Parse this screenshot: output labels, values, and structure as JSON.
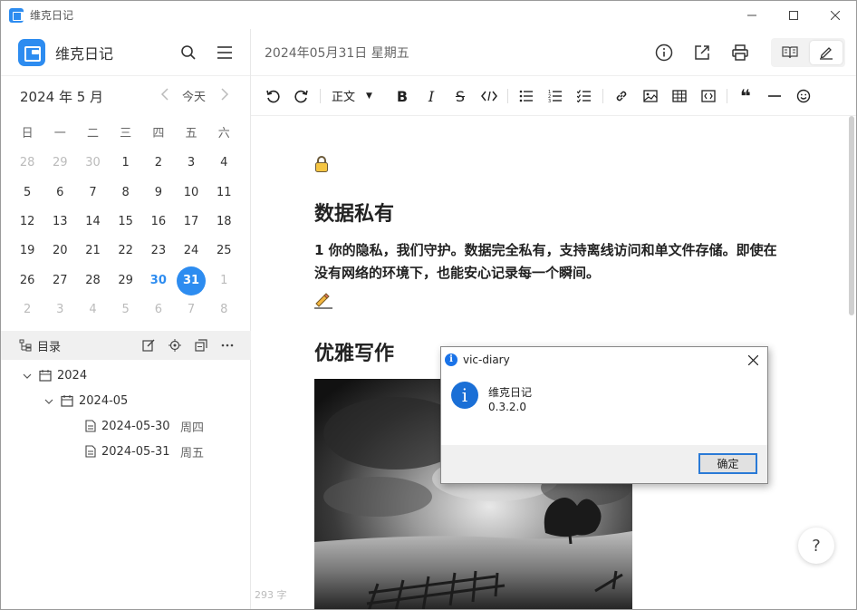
{
  "window": {
    "title": "维克日记"
  },
  "sidebar": {
    "app_name": "维克日记",
    "calendar": {
      "title": "2024 年 5 月",
      "today_label": "今天",
      "weekdays": [
        "日",
        "一",
        "二",
        "三",
        "四",
        "五",
        "六"
      ],
      "weeks": [
        [
          "28",
          "29",
          "30",
          "1",
          "2",
          "3",
          "4"
        ],
        [
          "5",
          "6",
          "7",
          "8",
          "9",
          "10",
          "11"
        ],
        [
          "12",
          "13",
          "14",
          "15",
          "16",
          "17",
          "18"
        ],
        [
          "19",
          "20",
          "21",
          "22",
          "23",
          "24",
          "25"
        ],
        [
          "26",
          "27",
          "28",
          "29",
          "30",
          "31",
          "1"
        ],
        [
          "2",
          "3",
          "4",
          "5",
          "6",
          "7",
          "8"
        ]
      ],
      "selected": "31",
      "highlighted": "30"
    },
    "toc_label": "目录",
    "tree": {
      "year": "2024",
      "month": "2024-05",
      "entries": [
        {
          "date": "2024-05-30",
          "weekday": "周四"
        },
        {
          "date": "2024-05-31",
          "weekday": "周五"
        }
      ]
    }
  },
  "main": {
    "date_title": "2024年05月31日 星期五",
    "toolbar": {
      "heading_select": "正文"
    },
    "content": {
      "emoji1": "🔒",
      "heading1": "数据私有",
      "paragraph1": "1 你的隐私，我们守护。数据完全私有，支持离线访问和单文件存储。即使在没有网络的环境下，也能安心记录每一个瞬间。",
      "emoji2": "✍",
      "heading2": "优雅写作"
    },
    "word_count": "293 字",
    "help_label": "?"
  },
  "dialog": {
    "title": "vic-diary",
    "line1": "维克日记",
    "line2": "0.3.2.0",
    "ok_label": "确定"
  },
  "colors": {
    "accent": "#2d8cf0",
    "selection_bg": "#eaf4fd",
    "toc_bar_bg": "#f0f0f0"
  }
}
